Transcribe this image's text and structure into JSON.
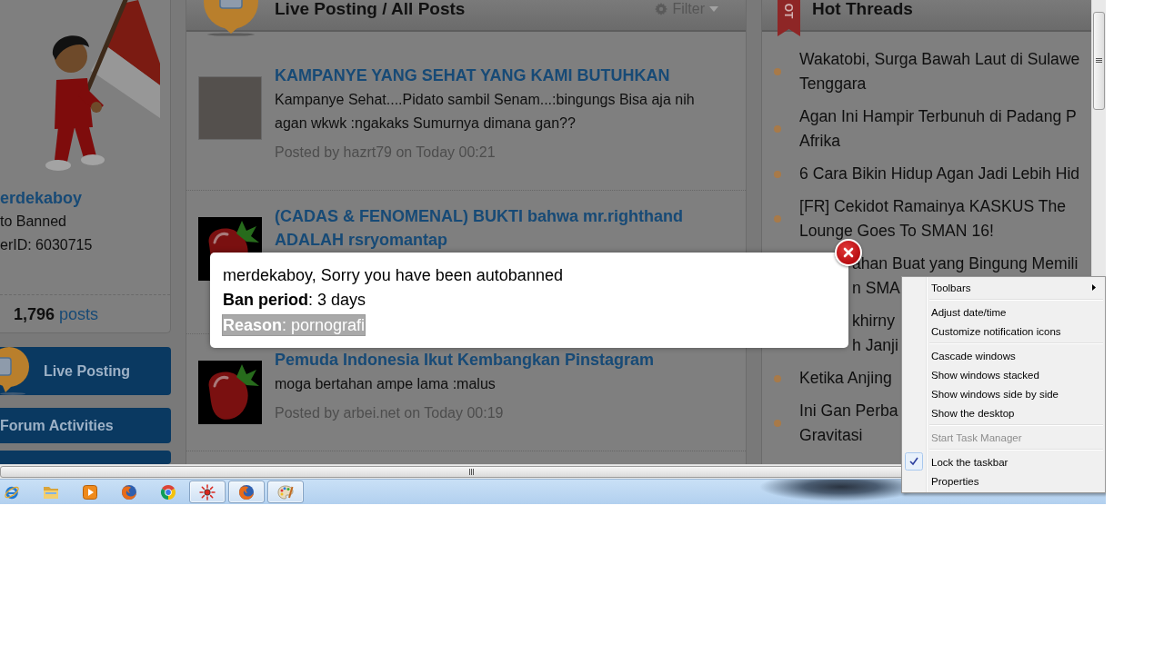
{
  "sidebar": {
    "username": "erdekaboy",
    "rank": "to Banned",
    "user_id": "erID: 6030715",
    "post_count": "1,796",
    "post_label": "posts",
    "buttons": [
      {
        "kind": "featured",
        "label": "Live Posting"
      },
      {
        "kind": "plain",
        "label": "Forum Activities"
      },
      {
        "kind": "plain"
      }
    ]
  },
  "live_posts": {
    "title": "Live Posting / All Posts",
    "filter": "Filter",
    "posts": [
      {
        "kind": "full",
        "title": "KAMPANYE YANG SEHAT YANG KAMI BUTUHKAN",
        "body": "Kampanye Sehat....Pidato sambil Senam...:bingungs Bisa aja nih agan wkwk :ngakaks Sumurnya dimana gan??",
        "meta": "Posted by hazrt79 on Today 00:21"
      },
      {
        "kind": "covered",
        "title": "(CADAS & FENOMENAL) BUKTI bahwa mr.righthand ADALAH rsryomantap"
      },
      {
        "kind": "full",
        "title": "Pemuda Indonesia Ikut Kembangkan Pinstagram",
        "body": "moga bertahan ampe lama :malus",
        "meta": "Posted by arbei.net on Today 00:19"
      }
    ]
  },
  "hot_threads": {
    "ribbon": "OT",
    "title": "Hot Threads",
    "items": [
      {
        "kind": "bulleted",
        "lines": [
          "Wakatobi, Surga Bawah Laut di Sulawe",
          "Tenggara"
        ]
      },
      {
        "kind": "bulleted",
        "lines": [
          "Agan Ini Hampir Terbunuh di Padang P",
          "Afrika"
        ]
      },
      {
        "kind": "bulleted",
        "lines": [
          "6 Cara Bikin Hidup Agan Jadi Lebih Hid"
        ]
      },
      {
        "kind": "bulleted",
        "lines": [
          "[FR] Cekidot Ramainya KASKUS The",
          "Lounge Goes To SMAN 16!"
        ]
      },
      {
        "kind": "covered",
        "lines": [
          "ahan Buat yang Bingung Memili",
          "n SMA"
        ]
      },
      {
        "kind": "covered",
        "lines": [
          "khirny",
          "h Janji"
        ]
      },
      {
        "kind": "bulleted",
        "lines": [
          "Ketika Anjing"
        ]
      },
      {
        "kind": "bulleted",
        "lines": [
          "Ini Gan Perba",
          "Gravitasi"
        ]
      }
    ]
  },
  "dialog": {
    "lines": [
      {
        "text": "merdekaboy, Sorry you have been autobanned",
        "highlighted": false
      },
      {
        "text": "**Ban period**: 3 days",
        "highlighted": false
      },
      {
        "text": "**Reason**: pornografi",
        "highlighted": true
      }
    ]
  },
  "context_menu": {
    "groups": [
      [
        {
          "label": "Toolbars",
          "submenu": true,
          "checked": false,
          "disabled": false
        }
      ],
      [
        {
          "label": "Adjust date/time",
          "submenu": false,
          "checked": false,
          "disabled": false
        },
        {
          "label": "Customize notification icons",
          "submenu": false,
          "checked": false,
          "disabled": false
        }
      ],
      [
        {
          "label": "Cascade windows",
          "submenu": false,
          "checked": false,
          "disabled": false
        },
        {
          "label": "Show windows stacked",
          "submenu": false,
          "checked": false,
          "disabled": false
        },
        {
          "label": "Show windows side by side",
          "submenu": false,
          "checked": false,
          "disabled": false
        },
        {
          "label": "Show the desktop",
          "submenu": false,
          "checked": false,
          "disabled": false
        }
      ],
      [
        {
          "label": "Start Task Manager",
          "submenu": false,
          "checked": false,
          "disabled": true
        }
      ],
      [
        {
          "label": "Lock the taskbar",
          "submenu": false,
          "checked": true,
          "disabled": false
        },
        {
          "label": "Properties",
          "submenu": false,
          "checked": false,
          "disabled": false
        }
      ]
    ]
  },
  "taskbar": {
    "buttons": [
      {
        "open": false
      },
      {
        "open": false
      },
      {
        "open": false
      },
      {
        "open": false
      },
      {
        "open": false
      },
      {
        "open": true
      },
      {
        "open": true
      },
      {
        "open": true
      }
    ]
  }
}
